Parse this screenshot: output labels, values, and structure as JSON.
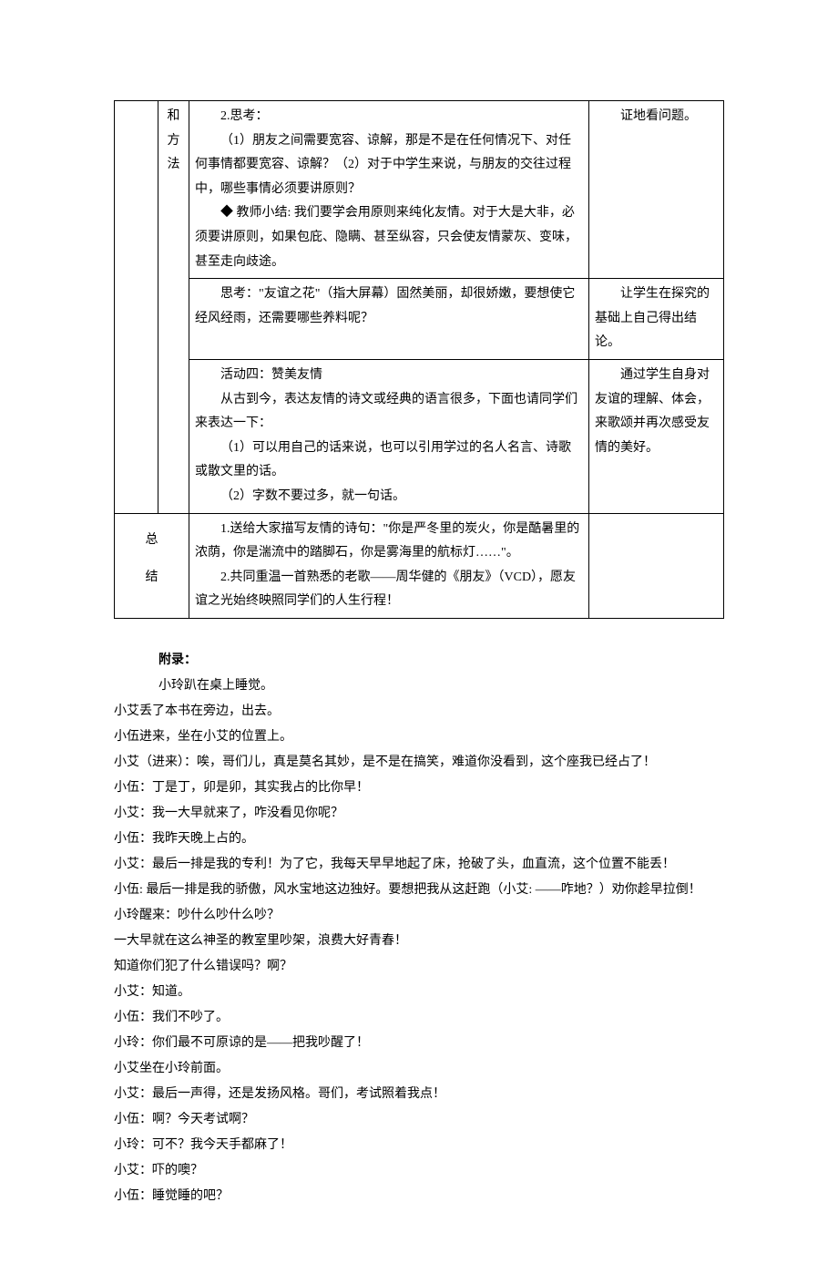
{
  "table": {
    "colB_row1": [
      "和",
      "方",
      "法"
    ],
    "row1_mid": {
      "l1": "2.思考：",
      "l2": "（1）朋友之间需要宽容、谅解，那是不是在任何情况下、对任何事情都要宽容、谅解？（2）对于中学生来说，与朋友的交往过程中，哪些事情必须要讲原则？",
      "l3": "◆ 教师小结: 我们要学会用原则来纯化友情。对于大是大非，必须要讲原则，如果包庇、隐瞒、甚至纵容，只会使友情蒙灰、变味，甚至走向歧途。"
    },
    "row1_right": "证地看问题。",
    "row2_mid": "思考：\"友谊之花\"（指大屏幕）固然美丽，却很娇嫩，要想使它经风经雨，还需要哪些养料呢？",
    "row2_right": "让学生在探究的基础上自己得出结论。",
    "row3_mid": {
      "l1": "活动四：赞美友情",
      "l2": "从古到今，表达友情的诗文或经典的语言很多，下面也请同学们来表达一下：",
      "l3": "（1）可以用自己的话来说，也可以引用学过的名人名言、诗歌或散文里的话。",
      "l4": "（2）字数不要过多，就一句话。"
    },
    "row3_right": "通过学生自身对友谊的理解、体会，来歌颂并再次感受友情的美好。",
    "colA_row4": [
      "总",
      "结"
    ],
    "row4_mid": {
      "l1": "1.送给大家描写友情的诗句：\"你是严冬里的炭火，你是酷暑里的浓荫，你是湍流中的踏脚石，你是雾海里的航标灯……\"。",
      "l2": "2.共同重温一首熟悉的老歌——周华健的《朋友》（VCD），愿友谊之光始终映照同学们的人生行程！"
    }
  },
  "appendix": {
    "title": "附录：",
    "lines": [
      "小玲趴在桌上睡觉。",
      "小艾丢了本书在旁边，出去。",
      "小伍进来，坐在小艾的位置上。",
      "小艾（进来）：唉，哥们儿，真是莫名其妙，是不是在搞笑，难道你没看到，这个座我已经占了！",
      "小伍：丁是丁，卯是卯，其实我占的比你早！",
      "小艾：我一大早就来了，咋没看见你呢？",
      "小伍：我昨天晚上占的。",
      "小艾：最后一排是我的专利！为了它，我每天早早地起了床，抢破了头，血直流，这个位置不能丢！",
      "小伍: 最后一排是我的骄傲，风水宝地这边独好。要想把我从这赶跑（小艾: ——咋地？）劝你趁早拉倒！",
      "小玲醒来：吵什么吵什么吵？",
      "一大早就在这么神圣的教室里吵架，浪费大好青春！",
      "知道你们犯了什么错误吗？啊？",
      "小艾：知道。",
      "小伍：我们不吵了。",
      "小玲：你们最不可原谅的是——把我吵醒了！",
      "小艾坐在小玲前面。",
      "小艾：最后一声得，还是发扬风格。哥们，考试照着我点！",
      "小伍：啊？今天考试啊？",
      "小玲：可不？我今天手都麻了！",
      "小艾：吓的噢？",
      "小伍：睡觉睡的吧？"
    ]
  }
}
